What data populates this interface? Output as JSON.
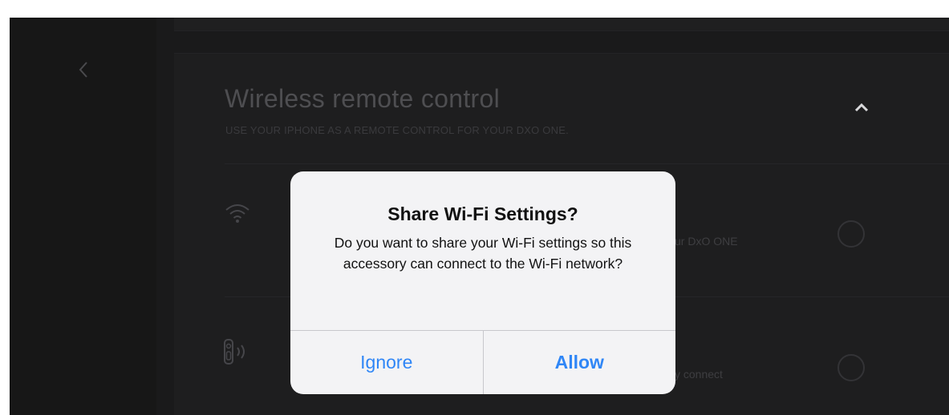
{
  "nav": {
    "back_icon": "chevron-left-icon"
  },
  "section": {
    "title": "Wireless remote control",
    "subtitle": "USE YOUR IPHONE AS A REMOTE CONTROL FOR YOUR DXO ONE.",
    "collapse_icon": "chevron-up-icon"
  },
  "options": [
    {
      "icon": "wifi-icon",
      "text_fragment": "ur DxO ONE"
    },
    {
      "icon": "camera-signal-icon",
      "text_fragment": "y connect"
    }
  ],
  "dialog": {
    "title": "Share Wi-Fi Settings?",
    "message": "Do you want to share your Wi-Fi settings so this accessory can connect to the Wi-Fi network?",
    "ignore_label": "Ignore",
    "allow_label": "Allow"
  },
  "colors": {
    "background": "#141414",
    "dialog_background": "#f3f3f5",
    "button_accent": "#2f86f6"
  }
}
